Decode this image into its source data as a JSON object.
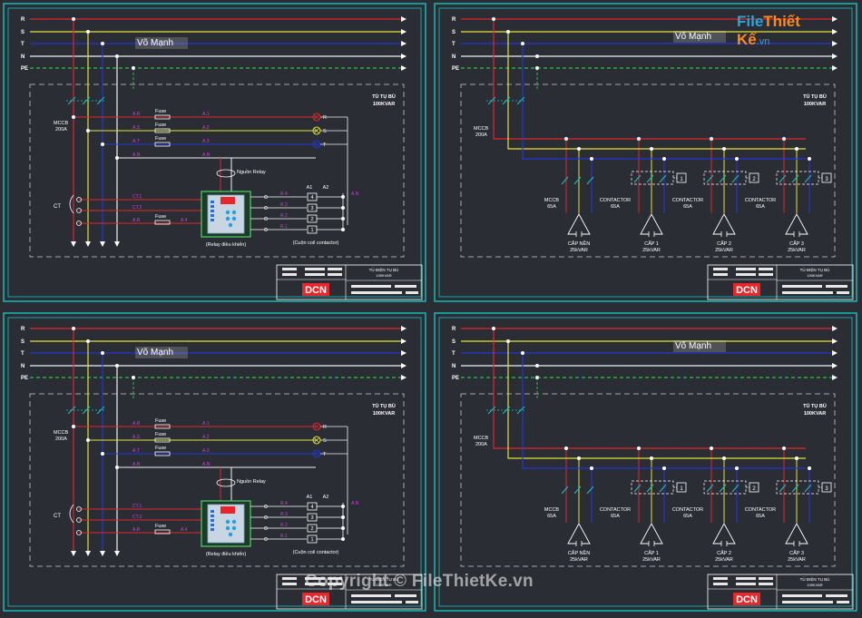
{
  "author_tag": "Võ Mạnh",
  "buses": [
    "R",
    "S",
    "T",
    "N",
    "PE"
  ],
  "colors": {
    "R": "#e0262b",
    "S": "#e2e23b",
    "T": "#2336d6",
    "N": "#f2f2f2",
    "PE": "#2bc24a",
    "frame": "#18c3c4",
    "dashed": "#c9c9c9",
    "label": "#ffffff",
    "wire_tag": "#d040d8",
    "background": "#2a2d34",
    "logo_red": "#e8262b"
  },
  "panel_title": [
    "TỦ TỤ BÙ",
    "100KVAR"
  ],
  "control": {
    "mccb": [
      "MCCB",
      "200A"
    ],
    "fuse": "Fuse",
    "wire_tags_left": [
      "A.R",
      "A.S",
      "A.T",
      "A.N"
    ],
    "wire_tags_mid": [
      "A.1",
      "A.2",
      "A.3"
    ],
    "ct_tags": [
      "CT.1",
      "CT.2",
      "A.R"
    ],
    "fuse_ct_tag": "A.4",
    "lamp_labels": [
      "R",
      "S",
      "T"
    ],
    "an_right": "A.N",
    "relay_supply": "Nguồn Relay",
    "ct_label": "CT",
    "relay_caption": "(Relay điều khiển)",
    "coil_caption": "(Cuộn coil contactor)",
    "outputs": [
      "R.4",
      "R.3",
      "R.2",
      "R.1"
    ],
    "terminals": [
      "4",
      "3",
      "2",
      "1"
    ],
    "terminal_heads": [
      "A1",
      "A2"
    ]
  },
  "power": {
    "mccb": [
      "MCCB",
      "200A"
    ],
    "branch_mccb": [
      "MCCB",
      "65A"
    ],
    "contactor": [
      "CONTACTOR",
      "65A"
    ],
    "step_numbers": [
      "1",
      "2",
      "3"
    ],
    "capacitors": [
      {
        "name": "CẤP NỀN",
        "rating": "25kVAR"
      },
      {
        "name": "CẤP 1",
        "rating": "25kVAR"
      },
      {
        "name": "CẤP 2",
        "rating": "25kVAR"
      },
      {
        "name": "CẤP 3",
        "rating": "25kVAR"
      }
    ]
  },
  "title_block": {
    "logo": "DCN",
    "drawing_title": "TỦ ĐIỆN TỤ BÙ",
    "drawing_sub": "100KVAR"
  },
  "watermark": {
    "site_a": "File",
    "site_b": "Thiết Kế",
    "site_c": ".vn",
    "copyright": "Copyright © FileThietKe.vn"
  }
}
